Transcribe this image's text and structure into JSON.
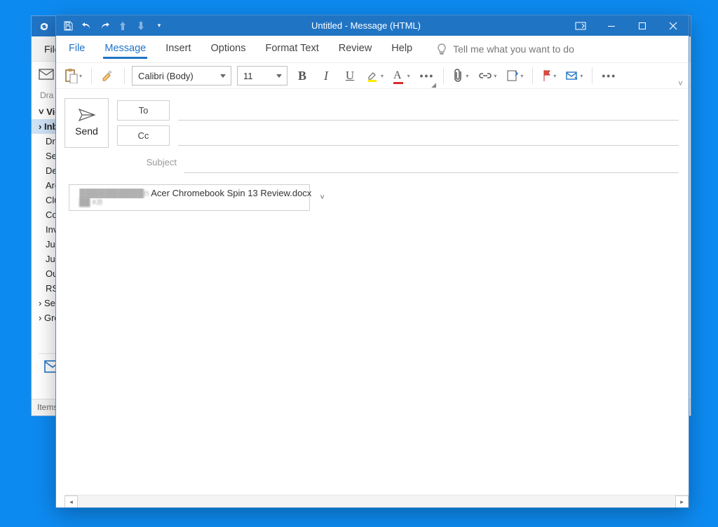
{
  "background": {
    "menu_file": "File",
    "sidebar": {
      "header": "Dra",
      "account": "Vic",
      "items": [
        "Inb",
        "Dra",
        "Ser",
        "Del",
        "Arc",
        "Clu",
        "Co",
        "Inv",
        "Jun",
        "Jun",
        "Ou",
        "RSS",
        "Sea",
        "Gro"
      ]
    },
    "status": "Items:"
  },
  "window": {
    "title": "Untitled  -  Message (HTML)"
  },
  "tabs": {
    "file": "File",
    "message": "Message",
    "insert": "Insert",
    "options": "Options",
    "format": "Format Text",
    "review": "Review",
    "help": "Help",
    "tellme": "Tell me what you want to do"
  },
  "format": {
    "font": "Calibri (Body)",
    "size": "11"
  },
  "compose": {
    "send": "Send",
    "to": "To",
    "cc": "Cc",
    "subject_label": "Subject"
  },
  "attachment": {
    "name_blur": "██████████n",
    "name": " Acer Chromebook Spin 13 Review.docx",
    "size": "██ KB"
  }
}
